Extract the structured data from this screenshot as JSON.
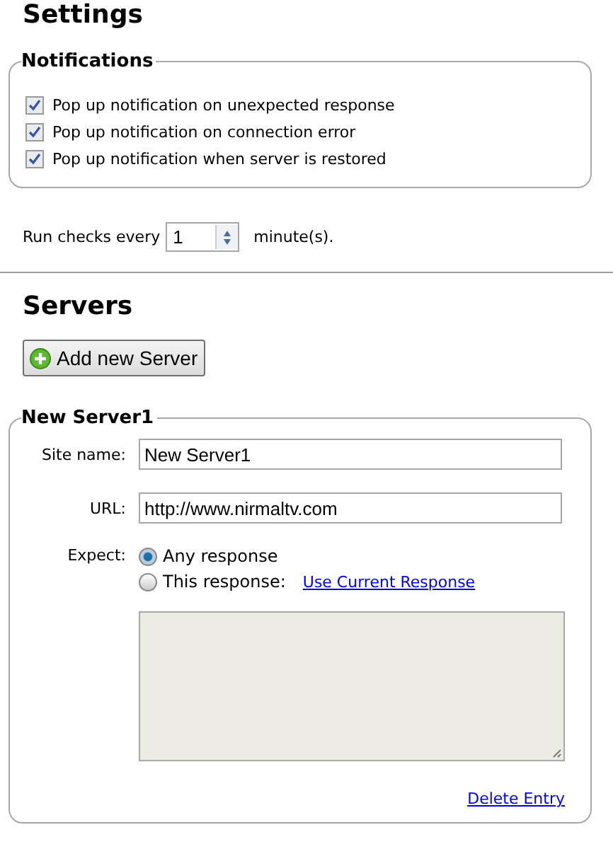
{
  "settings": {
    "title": "Settings",
    "notifications": {
      "legend": "Notifications",
      "options": [
        {
          "label": "Pop up notification on unexpected response",
          "checked": true
        },
        {
          "label": "Pop up notification on connection error",
          "checked": true
        },
        {
          "label": "Pop up notification when server is restored",
          "checked": true
        }
      ]
    },
    "interval": {
      "prefix": "Run checks every",
      "value": "1",
      "suffix": "minute(s)."
    }
  },
  "servers": {
    "title": "Servers",
    "add_button": "Add new Server",
    "entries": [
      {
        "legend": "New Server1",
        "site_name": {
          "label": "Site name:",
          "value": "New Server1"
        },
        "url": {
          "label": "URL:",
          "value": "http://www.nirmaltv.com"
        },
        "expect": {
          "label": "Expect:",
          "options": [
            {
              "label": "Any response",
              "selected": true
            },
            {
              "label": "This response:",
              "selected": false,
              "link": "Use Current Response"
            }
          ],
          "response_disabled": true
        },
        "delete_link": "Delete Entry"
      }
    ]
  }
}
